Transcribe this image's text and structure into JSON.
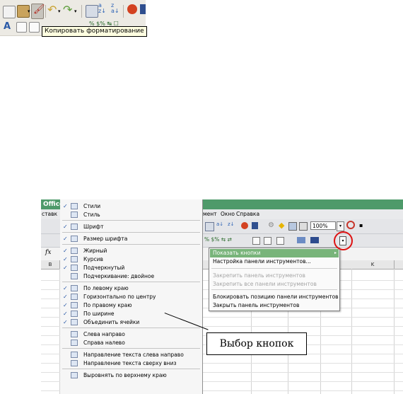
{
  "tooltip": {
    "text": "Копировать форматирование"
  },
  "window": {
    "title_fragment": "Office.",
    "left_fragment": "ставк"
  },
  "menubar": {
    "items": [
      "мент",
      "Окно",
      "Справка"
    ]
  },
  "toolbar": {
    "zoom_value": "100%"
  },
  "formula_bar": {
    "fx_label": "fx"
  },
  "column_headers": [
    "B",
    "K"
  ],
  "left_menu": {
    "groups": [
      [
        {
          "label": "Стили",
          "checked": true
        },
        {
          "label": "Стиль",
          "checked": false
        }
      ],
      [
        {
          "label": "Шрифт",
          "checked": true
        }
      ],
      [
        {
          "label": "Размер шрифта",
          "checked": true
        }
      ],
      [
        {
          "label": "Жирный",
          "checked": true
        },
        {
          "label": "Курсив",
          "checked": true
        },
        {
          "label": "Подчеркнутый",
          "checked": true
        },
        {
          "label": "Подчеркивание: двойное",
          "checked": false
        }
      ],
      [
        {
          "label": "По левому краю",
          "checked": true
        },
        {
          "label": "Горизонтально по центру",
          "checked": true
        },
        {
          "label": "По правому краю",
          "checked": true
        },
        {
          "label": "По ширине",
          "checked": true
        },
        {
          "label": "Объединить ячейки",
          "checked": true
        }
      ],
      [
        {
          "label": "Слева направо",
          "checked": false
        },
        {
          "label": "Справа налево",
          "checked": false
        }
      ],
      [
        {
          "label": "Направление текста слева направо",
          "checked": false
        },
        {
          "label": "Направление текста сверху вниз",
          "checked": false
        }
      ],
      [
        {
          "label": "Выровнять по верхнему краю",
          "checked": false
        }
      ]
    ]
  },
  "right_menu": {
    "items": [
      {
        "label": "Показать кнопки",
        "state": "highlighted",
        "submenu": true
      },
      {
        "label": "Настройка панели инструментов...",
        "state": "normal"
      },
      {
        "label": "Закрепить панель инструментов",
        "state": "disabled"
      },
      {
        "label": "Закрепить все панели инструментов",
        "state": "disabled"
      },
      {
        "label": "Блокировать позицию панели инструментов",
        "state": "normal"
      },
      {
        "label": "Закрыть панель инструментов",
        "state": "normal"
      }
    ]
  },
  "callout": {
    "text": "Выбор кнопок"
  },
  "colors": {
    "title_green": "#4e9a6a",
    "highlight_green": "#78b47a",
    "circle_red": "#d11111"
  }
}
